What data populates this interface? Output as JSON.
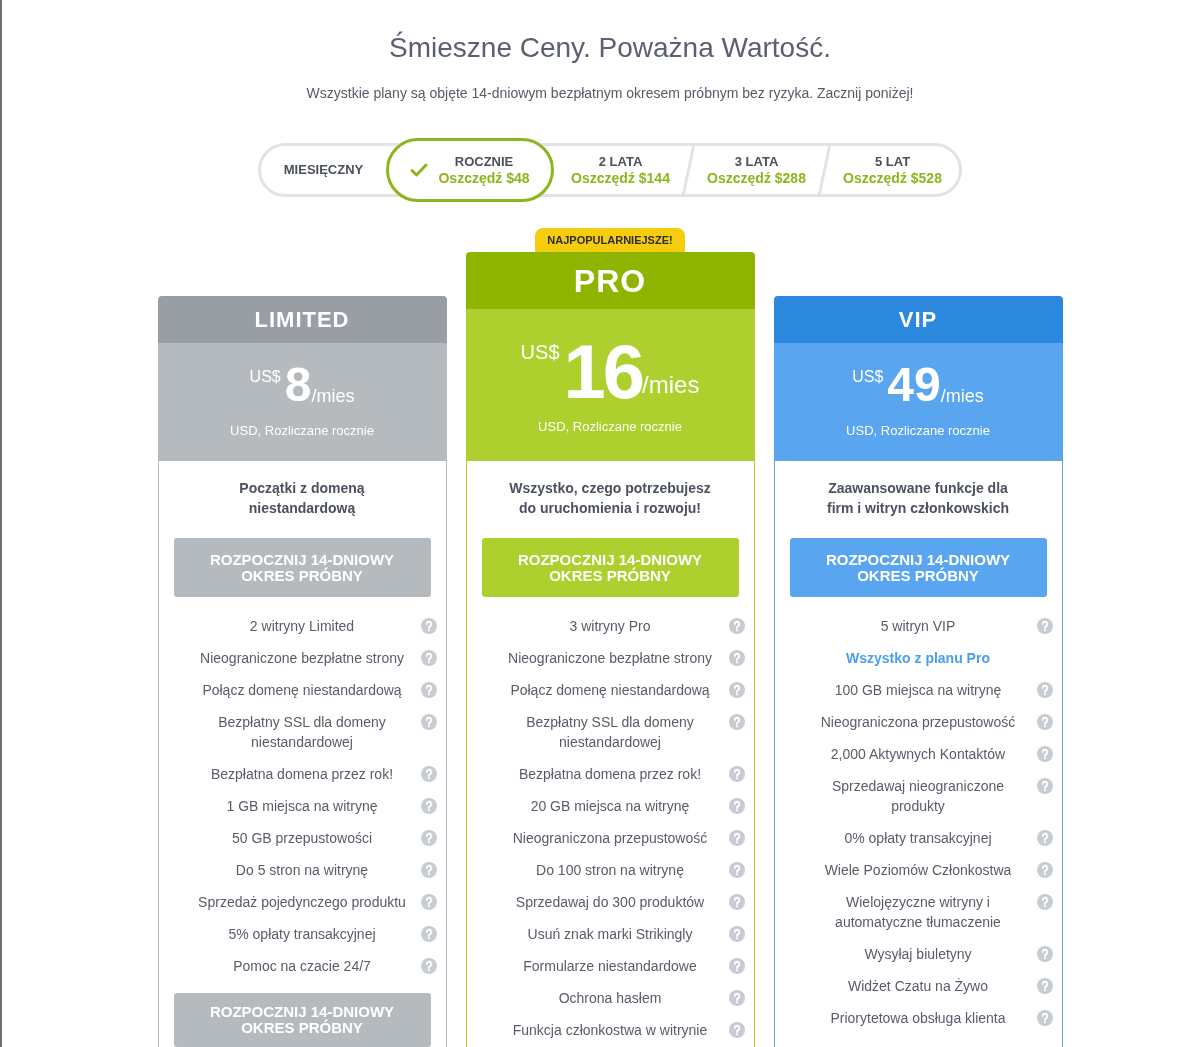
{
  "header": {
    "title": "Śmieszne Ceny. Poważna Wartość.",
    "subtitle": "Wszystkie plany są objęte 14-dniowym bezpłatnym okresem próbnym bez ryzyka. Zacznij poniżej!"
  },
  "billing_options": [
    {
      "label": "MIESIĘCZNY",
      "selected": false
    },
    {
      "label": "ROCZNIE",
      "savings": "Oszczędź $48",
      "selected": true
    },
    {
      "label": "2 LATA",
      "savings": "Oszczędź $144",
      "selected": false
    },
    {
      "label": "3 LATA",
      "savings": "Oszczędź $288",
      "selected": false
    },
    {
      "label": "5 LAT",
      "savings": "Oszczędź $528",
      "selected": false
    }
  ],
  "plans": [
    {
      "kind": "standard",
      "name": "LIMITED",
      "color": "#b5babf",
      "currency": "US$",
      "amount": "8",
      "period": "/mies",
      "billing_note": "USD, Rozliczane rocznie",
      "tagline": "Początki z domeną niestandardową",
      "button_top": "ROZPOCZNIJ 14-DNIOWY OKRES PRÓBNY",
      "features": [
        {
          "kind": "feature",
          "text": "2 witryny Limited"
        },
        {
          "kind": "feature",
          "text": "Nieograniczone bezpłatne strony"
        },
        {
          "kind": "feature",
          "text": "Połącz domenę niestandardową"
        },
        {
          "kind": "feature",
          "text": "Bezpłatny SSL dla domeny niestandardowej"
        },
        {
          "kind": "feature",
          "text": "Bezpłatna domena przez rok!"
        },
        {
          "kind": "feature",
          "text": "1 GB miejsca na witrynę"
        },
        {
          "kind": "feature",
          "text": "50 GB przepustowości"
        },
        {
          "kind": "feature",
          "text": "Do 5 stron na witrynę"
        },
        {
          "kind": "feature",
          "text": "Sprzedaż pojedynczego produktu"
        },
        {
          "kind": "feature",
          "text": "5% opłaty transakcyjnej"
        },
        {
          "kind": "feature",
          "text": "Pomoc na czacie 24/7"
        }
      ],
      "button_bottom": "ROZPOCZNIJ 14-DNIOWY OKRES PRÓBNY"
    },
    {
      "kind": "featured",
      "badge": "NAJPOPULARNIEJSZE!",
      "name": "PRO",
      "color": "#add02e",
      "currency": "US$",
      "amount": "16",
      "period": "/mies",
      "billing_note": "USD, Rozliczane rocznie",
      "tagline": "Wszystko, czego potrzebujesz do uruchomienia i rozwoju!",
      "button_top": "ROZPOCZNIJ 14-DNIOWY OKRES PRÓBNY",
      "features": [
        {
          "kind": "feature",
          "text": "3 witryny Pro"
        },
        {
          "kind": "feature",
          "text": "Nieograniczone bezpłatne strony"
        },
        {
          "kind": "feature",
          "text": "Połącz domenę niestandardową"
        },
        {
          "kind": "feature",
          "text": "Bezpłatny SSL dla domeny niestandardowej"
        },
        {
          "kind": "feature",
          "text": "Bezpłatna domena przez rok!"
        },
        {
          "kind": "feature",
          "text": "20 GB miejsca na witrynę"
        },
        {
          "kind": "feature",
          "text": "Nieograniczona przepustowość"
        },
        {
          "kind": "feature",
          "text": "Do 100 stron na witrynę"
        },
        {
          "kind": "feature",
          "text": "Sprzedawaj do 300 produktów"
        },
        {
          "kind": "feature",
          "text": "Usuń znak marki Strikingly"
        },
        {
          "kind": "feature",
          "text": "Formularze niestandardowe"
        },
        {
          "kind": "feature",
          "text": "Ochrona hasłem"
        },
        {
          "kind": "feature",
          "text": "Funkcja członkostwa w witrynie"
        }
      ]
    },
    {
      "kind": "standard",
      "name": "VIP",
      "color": "#5aa5f0",
      "currency": "US$",
      "amount": "49",
      "period": "/mies",
      "billing_note": "USD, Rozliczane rocznie",
      "tagline": "Zaawansowane funkcje dla firm i witryn członkowskich",
      "button_top": "ROZPOCZNIJ 14-DNIOWY OKRES PRÓBNY",
      "features": [
        {
          "kind": "feature",
          "text": "5 witryn VIP"
        },
        {
          "kind": "link",
          "text": "Wszystko z planu Pro"
        },
        {
          "kind": "feature",
          "text": "100 GB miejsca na witrynę"
        },
        {
          "kind": "feature",
          "text": "Nieograniczona przepustowość"
        },
        {
          "kind": "feature",
          "text": "2,000 Aktywnych Kontaktów"
        },
        {
          "kind": "feature",
          "text": "Sprzedawaj nieograniczone produkty"
        },
        {
          "kind": "feature",
          "text": "0% opłaty transakcyjnej"
        },
        {
          "kind": "feature",
          "text": "Wiele Poziomów Członkostwa"
        },
        {
          "kind": "feature",
          "text": "Wielojęzyczne witryny i automatyczne tłumaczenie"
        },
        {
          "kind": "feature",
          "text": "Wysyłaj biuletyny"
        },
        {
          "kind": "feature",
          "text": "Widżet Czatu na Żywo"
        },
        {
          "kind": "feature",
          "text": "Priorytetowa obsługa klienta"
        }
      ]
    }
  ]
}
